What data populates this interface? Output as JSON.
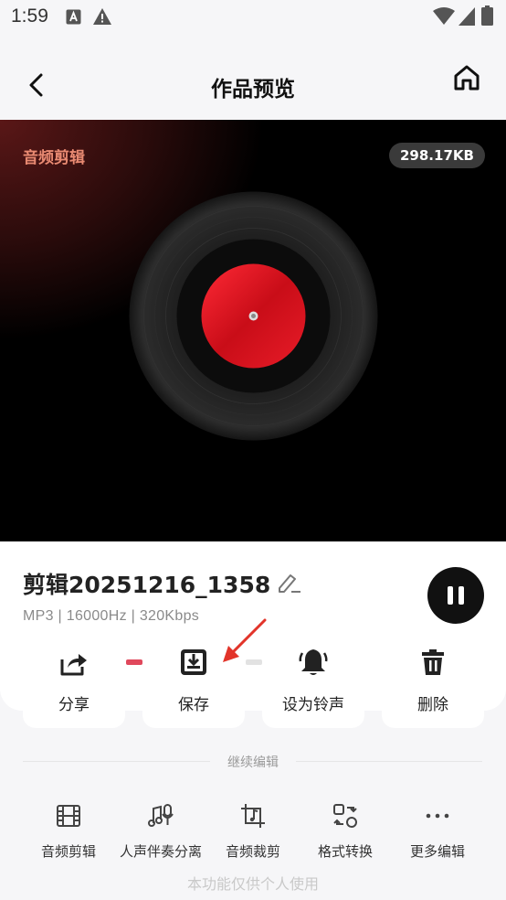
{
  "status_bar": {
    "time": "1:59"
  },
  "header": {
    "title": "作品预览"
  },
  "player": {
    "label": "音频剪辑",
    "file_size": "298.17KB"
  },
  "file": {
    "name": "剪辑20251216_1358",
    "meta": "MP3  |  16000Hz  |  320Kbps"
  },
  "actions": [
    {
      "label": "分享",
      "icon": "share-icon"
    },
    {
      "label": "保存",
      "icon": "download-icon"
    },
    {
      "label": "设为铃声",
      "icon": "bell-icon"
    },
    {
      "label": "删除",
      "icon": "trash-icon"
    }
  ],
  "continue_edit": {
    "title": "继续编辑",
    "tools": [
      {
        "label": "音频剪辑",
        "icon": "film-cut-icon"
      },
      {
        "label": "人声伴奏分离",
        "icon": "music-mic-icon"
      },
      {
        "label": "音频裁剪",
        "icon": "crop-music-icon"
      },
      {
        "label": "格式转换",
        "icon": "format-convert-icon"
      },
      {
        "label": "更多编辑",
        "icon": "more-icon"
      }
    ]
  },
  "footer": {
    "note": "本功能仅供个人使用"
  },
  "colors": {
    "accent_red": "#e0485c",
    "label_orange": "#e98a72",
    "disc_red": "#d9121d"
  }
}
